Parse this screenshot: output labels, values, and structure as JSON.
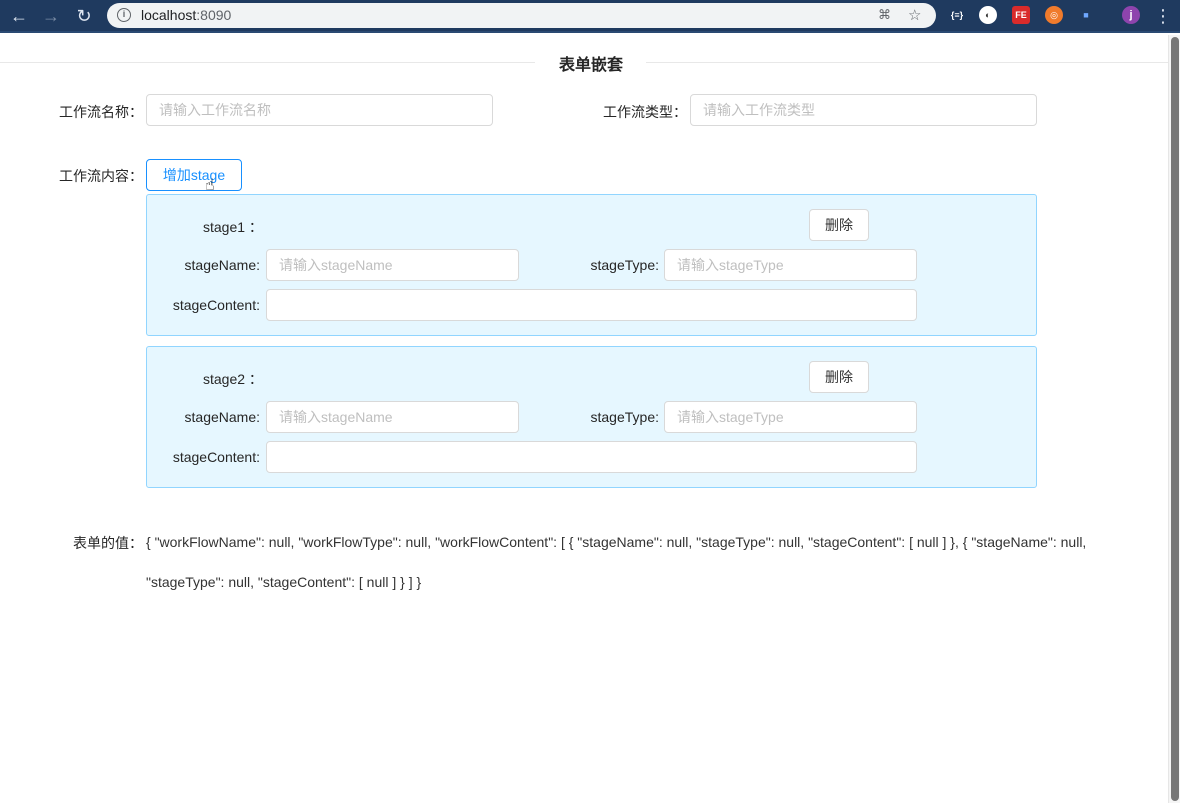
{
  "browser": {
    "url_host": "localhost",
    "url_port": ":8090"
  },
  "page": {
    "title": "表单嵌套"
  },
  "form": {
    "workflow_name_label": "工作流名称：",
    "workflow_name_placeholder": "请输入工作流名称",
    "workflow_type_label": "工作流类型：",
    "workflow_type_placeholder": "请输入工作流类型",
    "workflow_content_label": "工作流内容：",
    "add_stage_label": "增加stage"
  },
  "stages": [
    {
      "title": "stage1 ：",
      "delete_label": "删除",
      "name_label": "stageName:",
      "name_placeholder": "请输入stageName",
      "type_label": "stageType:",
      "type_placeholder": "请输入stageType",
      "content_label": "stageContent:",
      "content_value": ""
    },
    {
      "title": "stage2 ：",
      "delete_label": "删除",
      "name_label": "stageName:",
      "name_placeholder": "请输入stageName",
      "type_label": "stageType:",
      "type_placeholder": "请输入stageType",
      "content_label": "stageContent:",
      "content_value": ""
    }
  ],
  "result": {
    "label": "表单的值：",
    "value": "{ \"workFlowName\": null, \"workFlowType\": null, \"workFlowContent\": [ { \"stageName\": null, \"stageType\": null, \"stageContent\": [ null ] }, { \"stageName\": null, \"stageType\": null, \"stageContent\": [ null ] } ] }"
  }
}
